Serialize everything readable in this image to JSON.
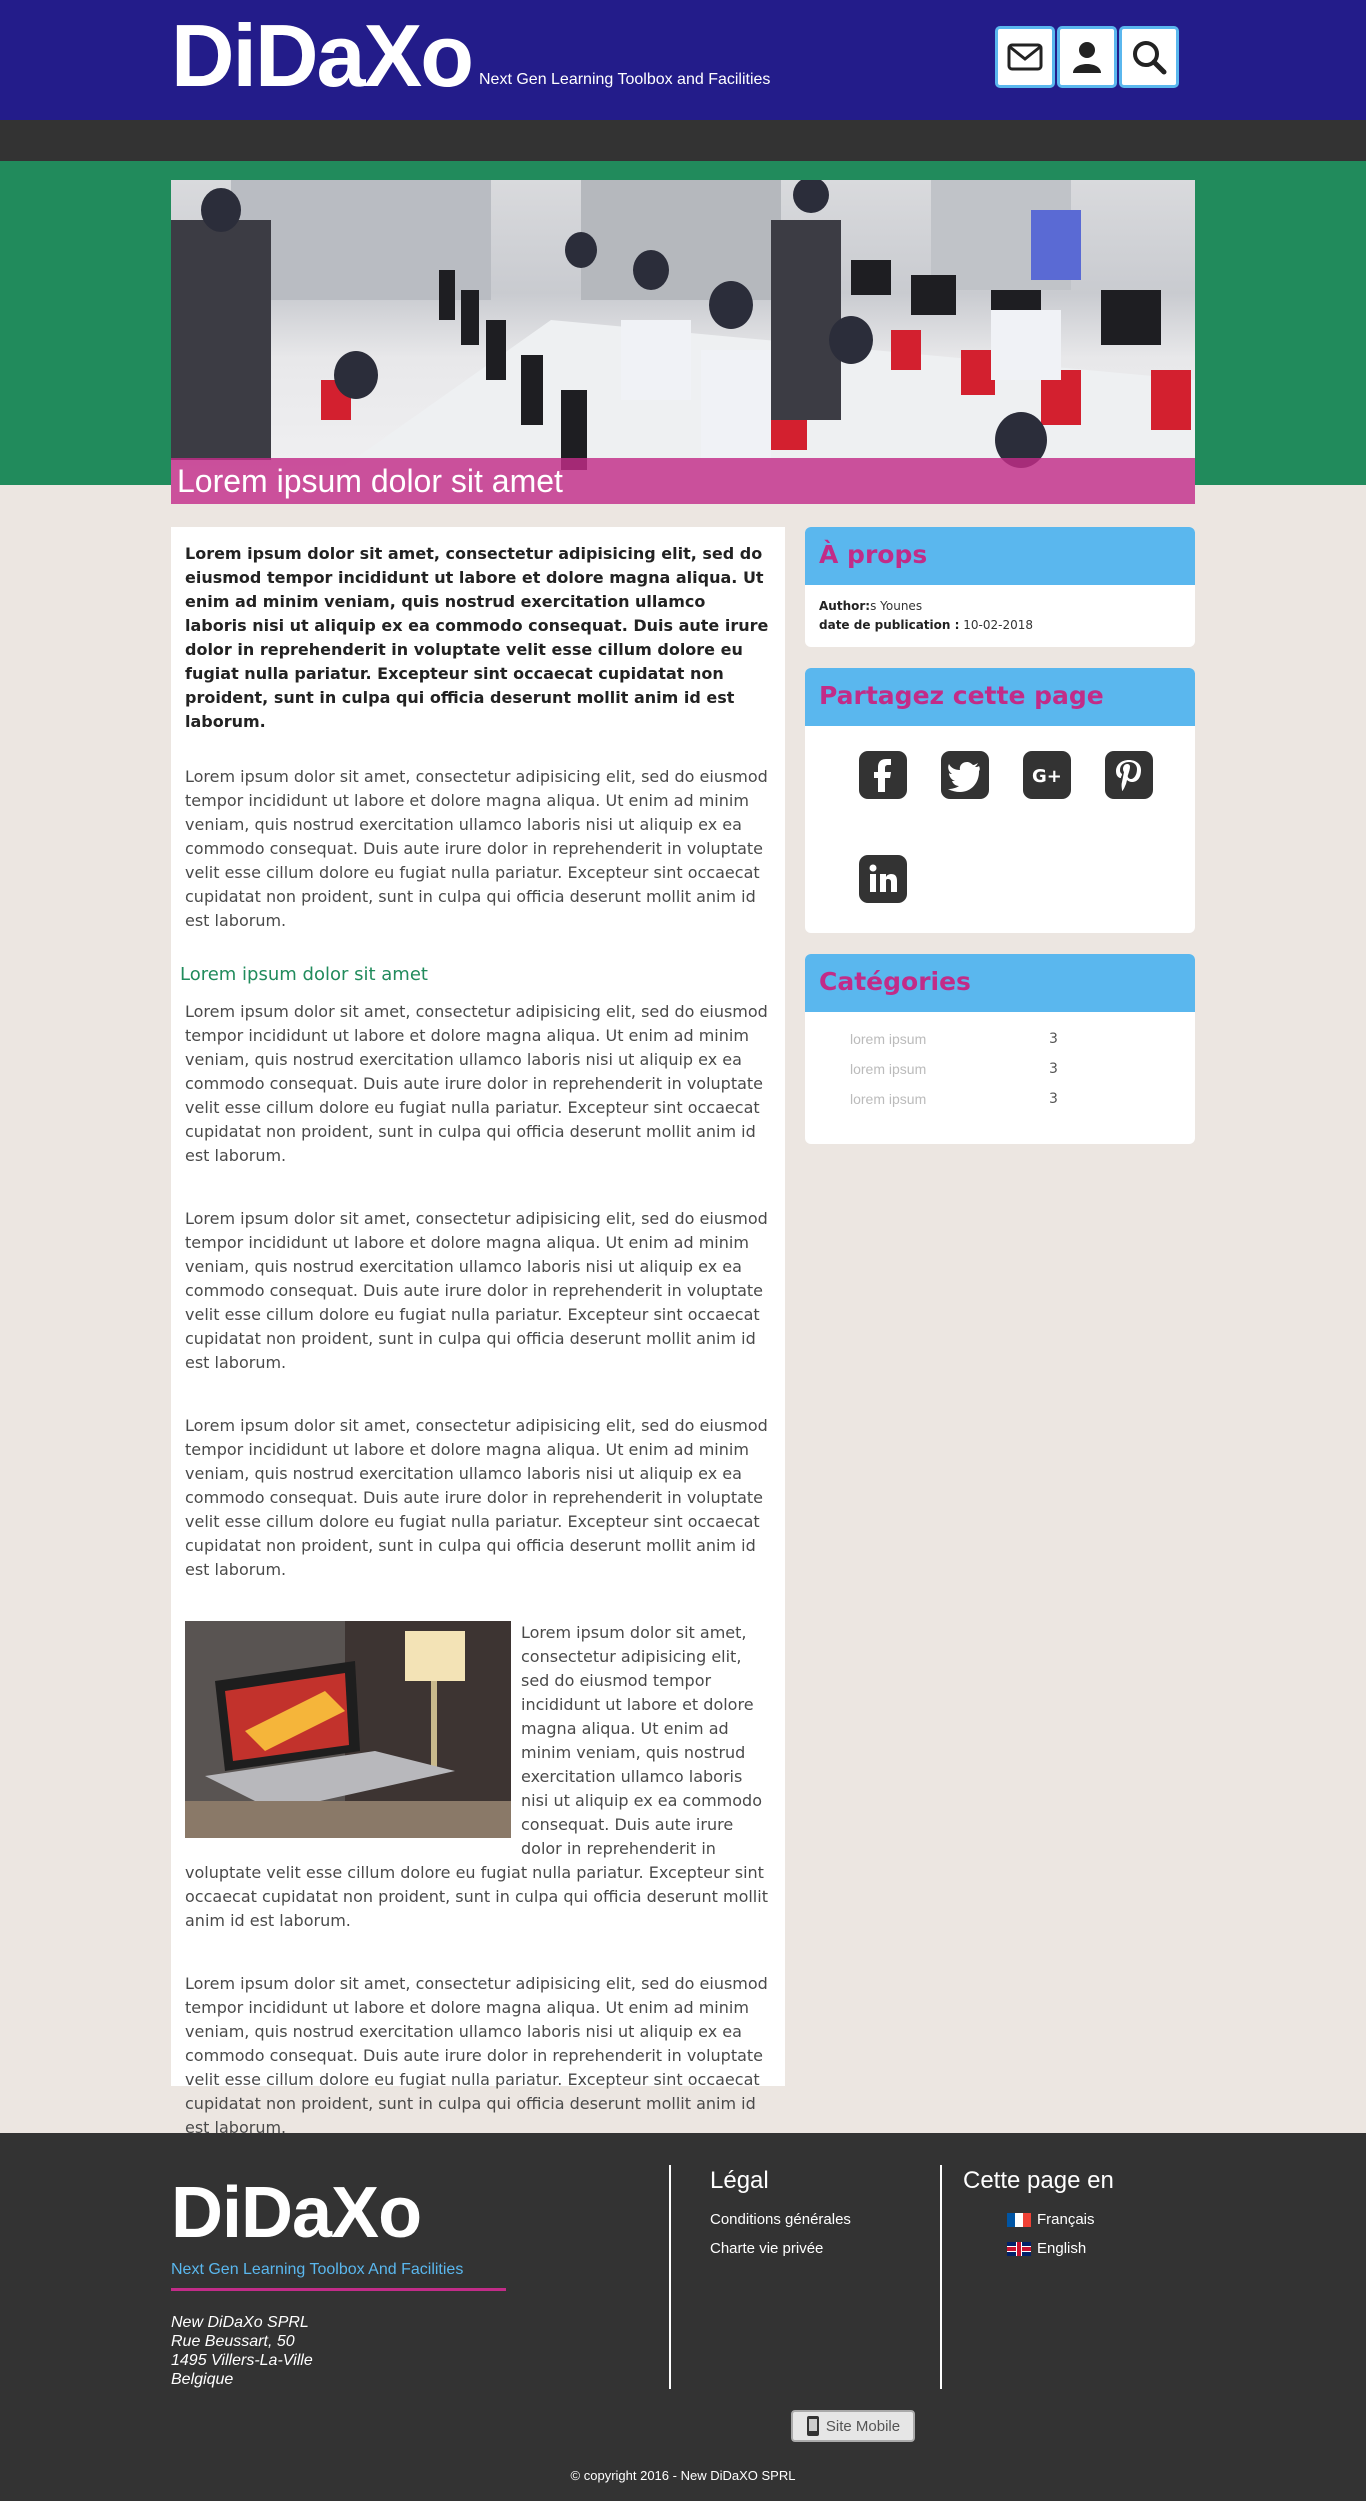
{
  "header": {
    "logo": "DiDaXo",
    "tagline": "Next Gen Learning Toolbox and Facilities",
    "icons": [
      "envelope-icon",
      "user-icon",
      "search-icon"
    ]
  },
  "hero": {
    "caption": "Lorem ipsum dolor sit amet"
  },
  "article": {
    "lead": "Lorem ipsum dolor sit amet, consectetur adipisicing elit, sed do eiusmod tempor incididunt ut labore et dolore magna aliqua. Ut enim ad minim veniam, quis nostrud exercitation ullamco laboris nisi ut aliquip ex ea commodo consequat. Duis aute irure dolor in reprehenderit in voluptate velit esse cillum dolore eu fugiat nulla pariatur. Excepteur sint occaecat cupidatat non proident, sunt in culpa qui officia deserunt mollit anim id est laborum.",
    "p1": "Lorem ipsum dolor sit amet, consectetur adipisicing elit, sed do eiusmod tempor incididunt ut labore et dolore magna aliqua. Ut enim ad minim veniam, quis nostrud exercitation ullamco laboris nisi ut aliquip ex ea commodo consequat. Duis aute irure dolor in reprehenderit in voluptate velit esse cillum dolore eu fugiat nulla pariatur. Excepteur sint occaecat cupidatat non proident, sunt in culpa qui officia deserunt mollit anim id est laborum.",
    "subheading": "Lorem ipsum dolor sit amet",
    "p2": "Lorem ipsum dolor sit amet, consectetur adipisicing elit, sed do eiusmod tempor incididunt ut labore et dolore magna aliqua. Ut enim ad minim veniam, quis nostrud exercitation ullamco laboris nisi ut aliquip ex ea commodo consequat. Duis aute irure dolor in reprehenderit in voluptate velit esse cillum dolore eu fugiat nulla pariatur. Excepteur sint occaecat cupidatat non proident, sunt in culpa qui officia deserunt mollit anim id est laborum.",
    "p3": "Lorem ipsum dolor sit amet, consectetur adipisicing elit, sed do eiusmod tempor incididunt ut labore et dolore magna aliqua. Ut enim ad minim veniam, quis nostrud exercitation ullamco laboris nisi ut aliquip ex ea commodo consequat. Duis aute irure dolor in reprehenderit in voluptate velit esse cillum dolore eu fugiat nulla pariatur. Excepteur sint occaecat cupidatat non proident, sunt in culpa qui officia deserunt mollit anim id est laborum.",
    "p4": "Lorem ipsum dolor sit amet, consectetur adipisicing elit, sed do eiusmod tempor incididunt ut labore et dolore magna aliqua. Ut enim ad minim veniam, quis nostrud exercitation ullamco laboris nisi ut aliquip ex ea commodo consequat. Duis aute irure dolor in reprehenderit in voluptate velit esse cillum dolore eu fugiat nulla pariatur. Excepteur sint occaecat cupidatat non proident, sunt in culpa qui officia deserunt mollit anim id est laborum.",
    "p5": "Lorem ipsum dolor sit amet, consectetur adipisicing elit, sed do eiusmod tempor incididunt ut labore et dolore magna aliqua. Ut enim ad minim veniam, quis nostrud exercitation ullamco laboris nisi ut aliquip ex ea commodo consequat. Duis aute irure dolor in reprehenderit in voluptate velit esse cillum dolore eu fugiat nulla pariatur. Excepteur sint occaecat cupidatat non proident, sunt in culpa qui officia deserunt mollit anim id est laborum.",
    "p6": "Lorem ipsum dolor sit amet, consectetur adipisicing elit, sed do eiusmod tempor incididunt ut labore et dolore magna aliqua. Ut enim ad minim veniam, quis nostrud exercitation ullamco laboris nisi ut aliquip ex ea commodo consequat. Duis aute irure dolor in reprehenderit in voluptate velit esse cillum dolore eu fugiat nulla pariatur. Excepteur sint occaecat cupidatat non proident, sunt in culpa qui officia deserunt mollit anim id est laborum."
  },
  "sidebar": {
    "about": {
      "title": "À props",
      "author_label": "Author:",
      "author_value": "s Younes",
      "date_label": "date de publication :",
      "date_value": "10-02-2018"
    },
    "share": {
      "title": "Partagez cette page",
      "icons": [
        "facebook-icon",
        "twitter-icon",
        "google-plus-icon",
        "pinterest-icon",
        "linkedin-icon"
      ]
    },
    "categories": {
      "title": "Catégories",
      "items": [
        {
          "name": "lorem ipsum",
          "count": "3"
        },
        {
          "name": "lorem ipsum",
          "count": "3"
        },
        {
          "name": "lorem ipsum",
          "count": "3"
        }
      ]
    }
  },
  "footer": {
    "logo": "DiDaXo",
    "tagline": "Next Gen Learning Toolbox And Facilities",
    "address": [
      "New DiDaXo SPRL",
      "Rue Beussart, 50",
      "1495 Villers-La-Ville",
      "Belgique"
    ],
    "legal": {
      "title": "Légal",
      "links": [
        "Conditions générales",
        "Charte vie privée"
      ]
    },
    "languages": {
      "title": "Cette page en",
      "links": [
        "Français",
        "English"
      ]
    },
    "mobile_button": "Site Mobile",
    "copyright": "© copyright 2016 - New DiDaXO SPRL"
  },
  "colors": {
    "header_bg": "#231c8a",
    "hero_band": "#218b5c",
    "accent_pink": "#c22c88",
    "accent_blue": "#5ab7ee",
    "page_bg": "#ece6e1",
    "dark": "#333333"
  }
}
